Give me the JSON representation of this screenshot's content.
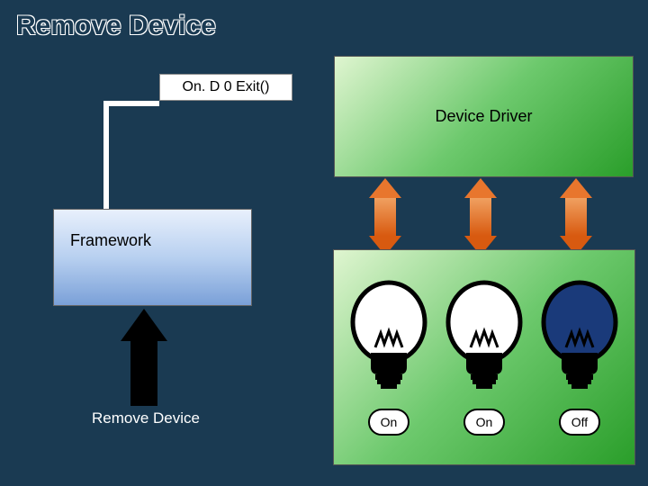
{
  "title": "Remove Device",
  "callback_label": "On. D 0 Exit()",
  "driver_label": "Device Driver",
  "framework_label": "Framework",
  "remove_label": "Remove Device",
  "bulbs": [
    {
      "state": "On",
      "lit": true
    },
    {
      "state": "On",
      "lit": true
    },
    {
      "state": "Off",
      "lit": false
    }
  ],
  "colors": {
    "bulb_on_fill": "#ffffff",
    "bulb_off_fill": "#1a3a7a",
    "accent": "#e8762d"
  }
}
